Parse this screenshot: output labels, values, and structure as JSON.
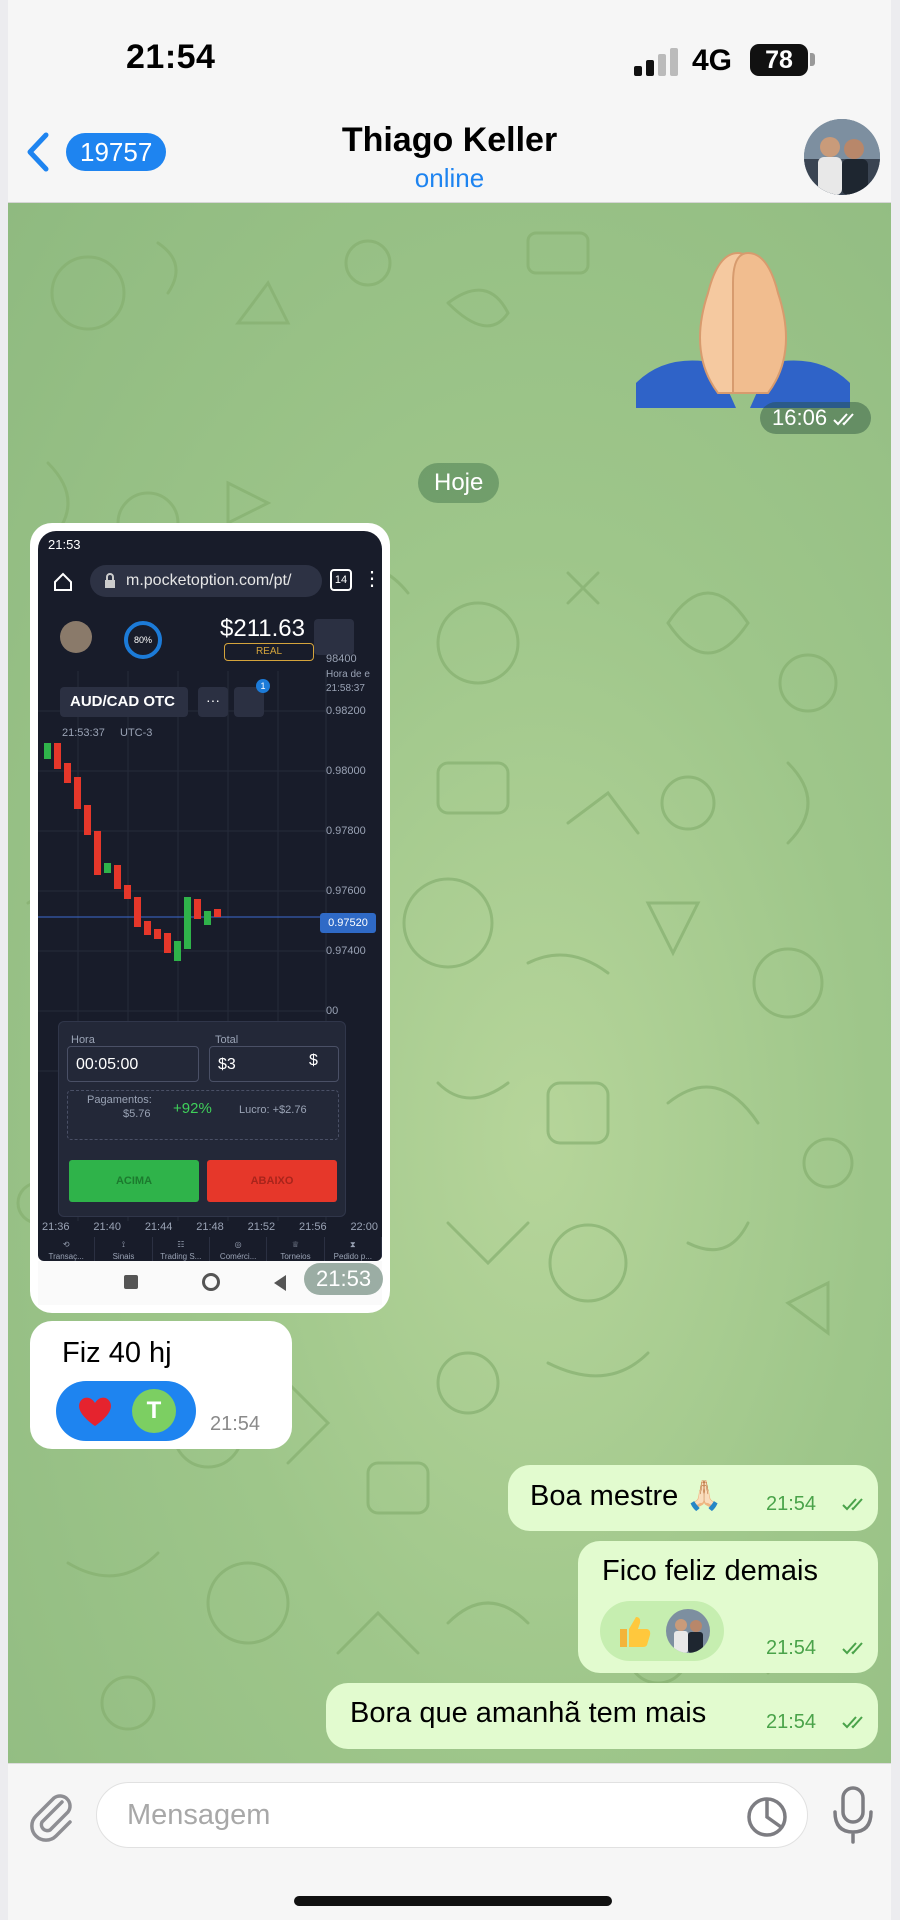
{
  "status_bar": {
    "time": "21:54",
    "network": "4G",
    "battery": "78"
  },
  "header": {
    "back_count": "19757",
    "contact_name": "Thiago Keller",
    "contact_status": "online"
  },
  "chat": {
    "sticker": {
      "time": "16:06"
    },
    "date_separator": "Hoje",
    "screenshot": {
      "time": "21:53",
      "phone_status_time": "21:53",
      "url": "m.pocketoption.com/pt/",
      "tab_count": "14",
      "balance": "$211.63",
      "account_type": "REAL",
      "percent": "80%",
      "pair": "AUD/CAD OTC",
      "chart_timestamp": "21:53:37",
      "timezone": "UTC-3",
      "badge_count": "1",
      "hora_de": "Hora de e",
      "hora_de_time": "21:58:37",
      "prices": [
        "98400",
        "0.98200",
        "0.98000",
        "0.97800",
        "0.97600",
        "0.97400",
        "00"
      ],
      "current_price": "0.97520",
      "time_label": "Hora",
      "time_value": "00:05:00",
      "total_label": "Total",
      "total_value": "$3",
      "currency_symbol": "$",
      "payout_label": "Pagamentos:",
      "payout_value": "$5.76",
      "payout_percent": "+92%",
      "profit": "Lucro: +$2.76",
      "buy_label": "ACIMA",
      "sell_label": "ABAIXO",
      "time_axis": [
        "21:36",
        "21:40",
        "21:44",
        "21:48",
        "21:52",
        "21:56",
        "22:00"
      ],
      "tabs": [
        "Transaç...",
        "Sinais",
        "Trading S...",
        "Comérci...",
        "Torneios",
        "Pedido p..."
      ]
    },
    "incoming": [
      {
        "text": "Fiz 40 hj",
        "time": "21:54",
        "reaction_letter": "T"
      }
    ],
    "outgoing": [
      {
        "text": "Boa mestre 🙏🏻",
        "time": "21:54"
      },
      {
        "text": "Fico feliz demais",
        "time": "21:54"
      },
      {
        "text": "Bora que amanhã tem mais",
        "time": "21:54"
      }
    ]
  },
  "input": {
    "placeholder": "Mensagem"
  },
  "colors": {
    "accent": "#1e84f0",
    "outgoing_bubble": "#e2fbcf",
    "read_check": "#4aa34a"
  },
  "icons": [
    "back-chevron-icon",
    "signal-icon",
    "battery-icon",
    "attach-icon",
    "sticker-icon",
    "microphone-icon",
    "double-check-icon",
    "heart-icon",
    "thumbs-up-icon",
    "praying-hands-sticker"
  ]
}
